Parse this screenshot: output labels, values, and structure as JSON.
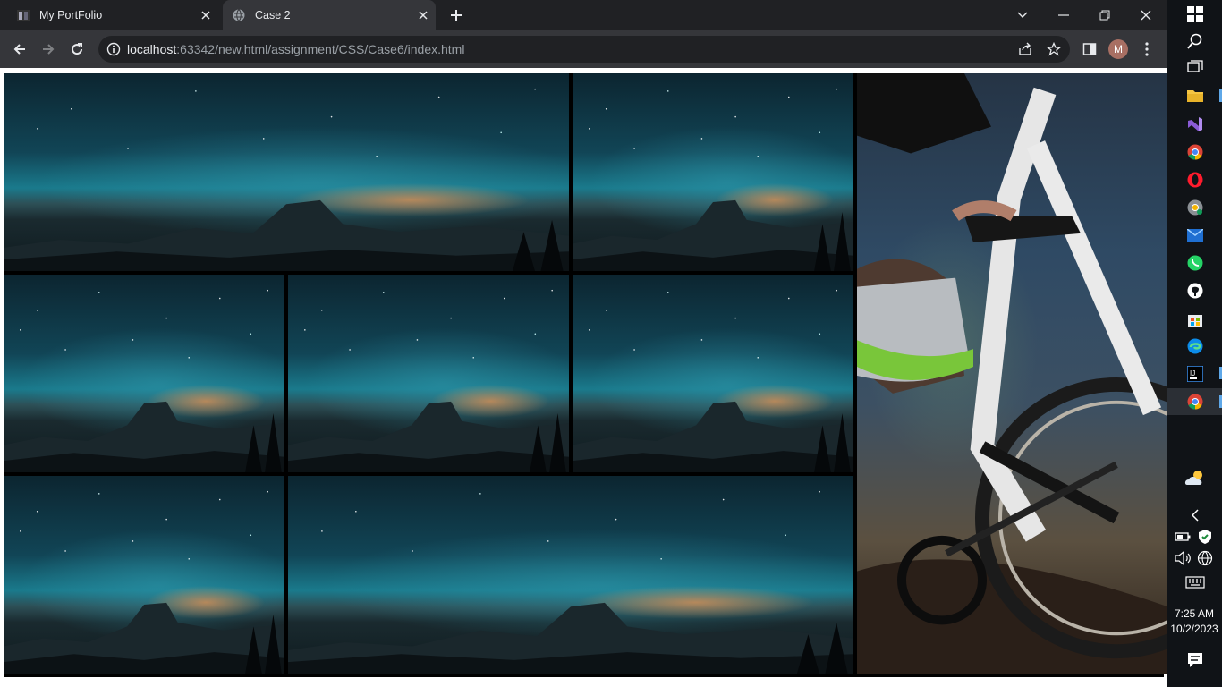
{
  "browser": {
    "tabs": [
      {
        "title": "My PortFolio",
        "active": false
      },
      {
        "title": "Case 2",
        "active": true
      }
    ],
    "address": {
      "host": "localhost",
      "path": ":63342/new.html/assignment/CSS/Case6/index.html"
    },
    "profile_initial": "M"
  },
  "page": {
    "gallery": [
      {
        "name": "night-photo-1",
        "kind": "night-sky"
      },
      {
        "name": "night-photo-2",
        "kind": "night-sky"
      },
      {
        "name": "night-photo-3",
        "kind": "night-sky"
      },
      {
        "name": "night-photo-4",
        "kind": "night-sky"
      },
      {
        "name": "night-photo-5",
        "kind": "night-sky"
      },
      {
        "name": "night-photo-6",
        "kind": "night-sky"
      },
      {
        "name": "night-photo-7",
        "kind": "night-sky"
      },
      {
        "name": "bike-photo",
        "kind": "mountain-bike"
      }
    ]
  },
  "taskbar": {
    "time": "7:25 AM",
    "date": "10/2/2023",
    "icons": [
      "windows-start-icon",
      "search-icon",
      "task-view-icon",
      "file-explorer-icon",
      "visual-studio-icon",
      "chrome-icon",
      "opera-icon",
      "chrome-dev-icon",
      "mail-icon",
      "whatsapp-icon",
      "github-icon",
      "store-icon",
      "edge-icon",
      "intellij-icon",
      "chrome-active-icon"
    ]
  },
  "colors": {
    "chrome_dark": "#202124",
    "toolbar": "#35363a",
    "taskbar": "#101317",
    "accent": "#5fa8e8"
  }
}
